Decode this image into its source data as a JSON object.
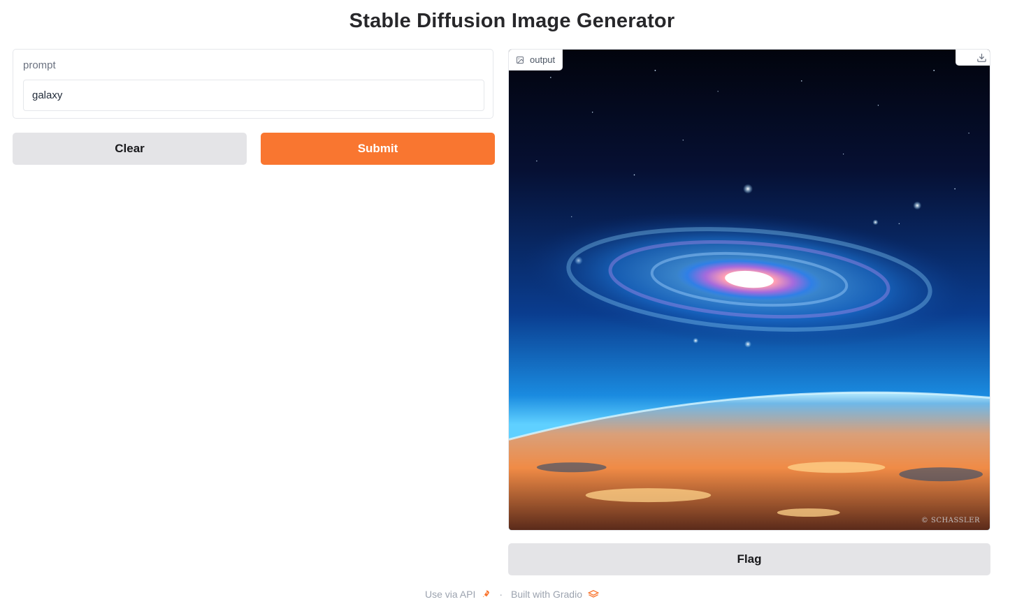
{
  "page": {
    "title": "Stable Diffusion Image Generator"
  },
  "inputs": {
    "prompt_label": "prompt",
    "prompt_value": "galaxy"
  },
  "actions": {
    "clear_label": "Clear",
    "submit_label": "Submit",
    "flag_label": "Flag"
  },
  "output": {
    "label": "output",
    "image_icon": "image-icon",
    "download_icon": "download-icon",
    "watermark_text": "© SCHASSLER"
  },
  "footer": {
    "api_link": "Use via API",
    "api_icon": "rocket-icon",
    "separator": "·",
    "built_with": "Built with Gradio",
    "gradio_icon": "gradio-logo-icon"
  },
  "colors": {
    "accent": "#f97630",
    "secondary_button": "#e4e4e7"
  }
}
